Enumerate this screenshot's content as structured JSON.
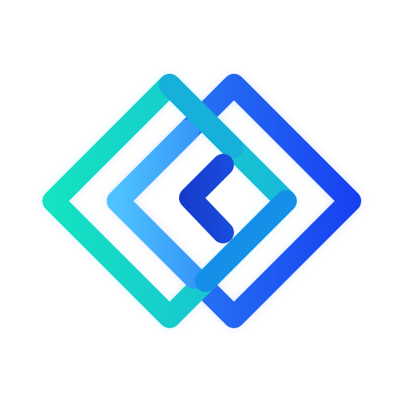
{
  "logo": {
    "icon": "interlocking-diamonds-logo-icon",
    "colors": {
      "teal": "#14E3C0",
      "cyan": "#18B9D8",
      "sky": "#4FC3FF",
      "azure": "#2E8BF2",
      "blue": "#1A66F0",
      "royal": "#1740F2",
      "navy": "#1639C9",
      "background": "#FFFFFF"
    }
  }
}
